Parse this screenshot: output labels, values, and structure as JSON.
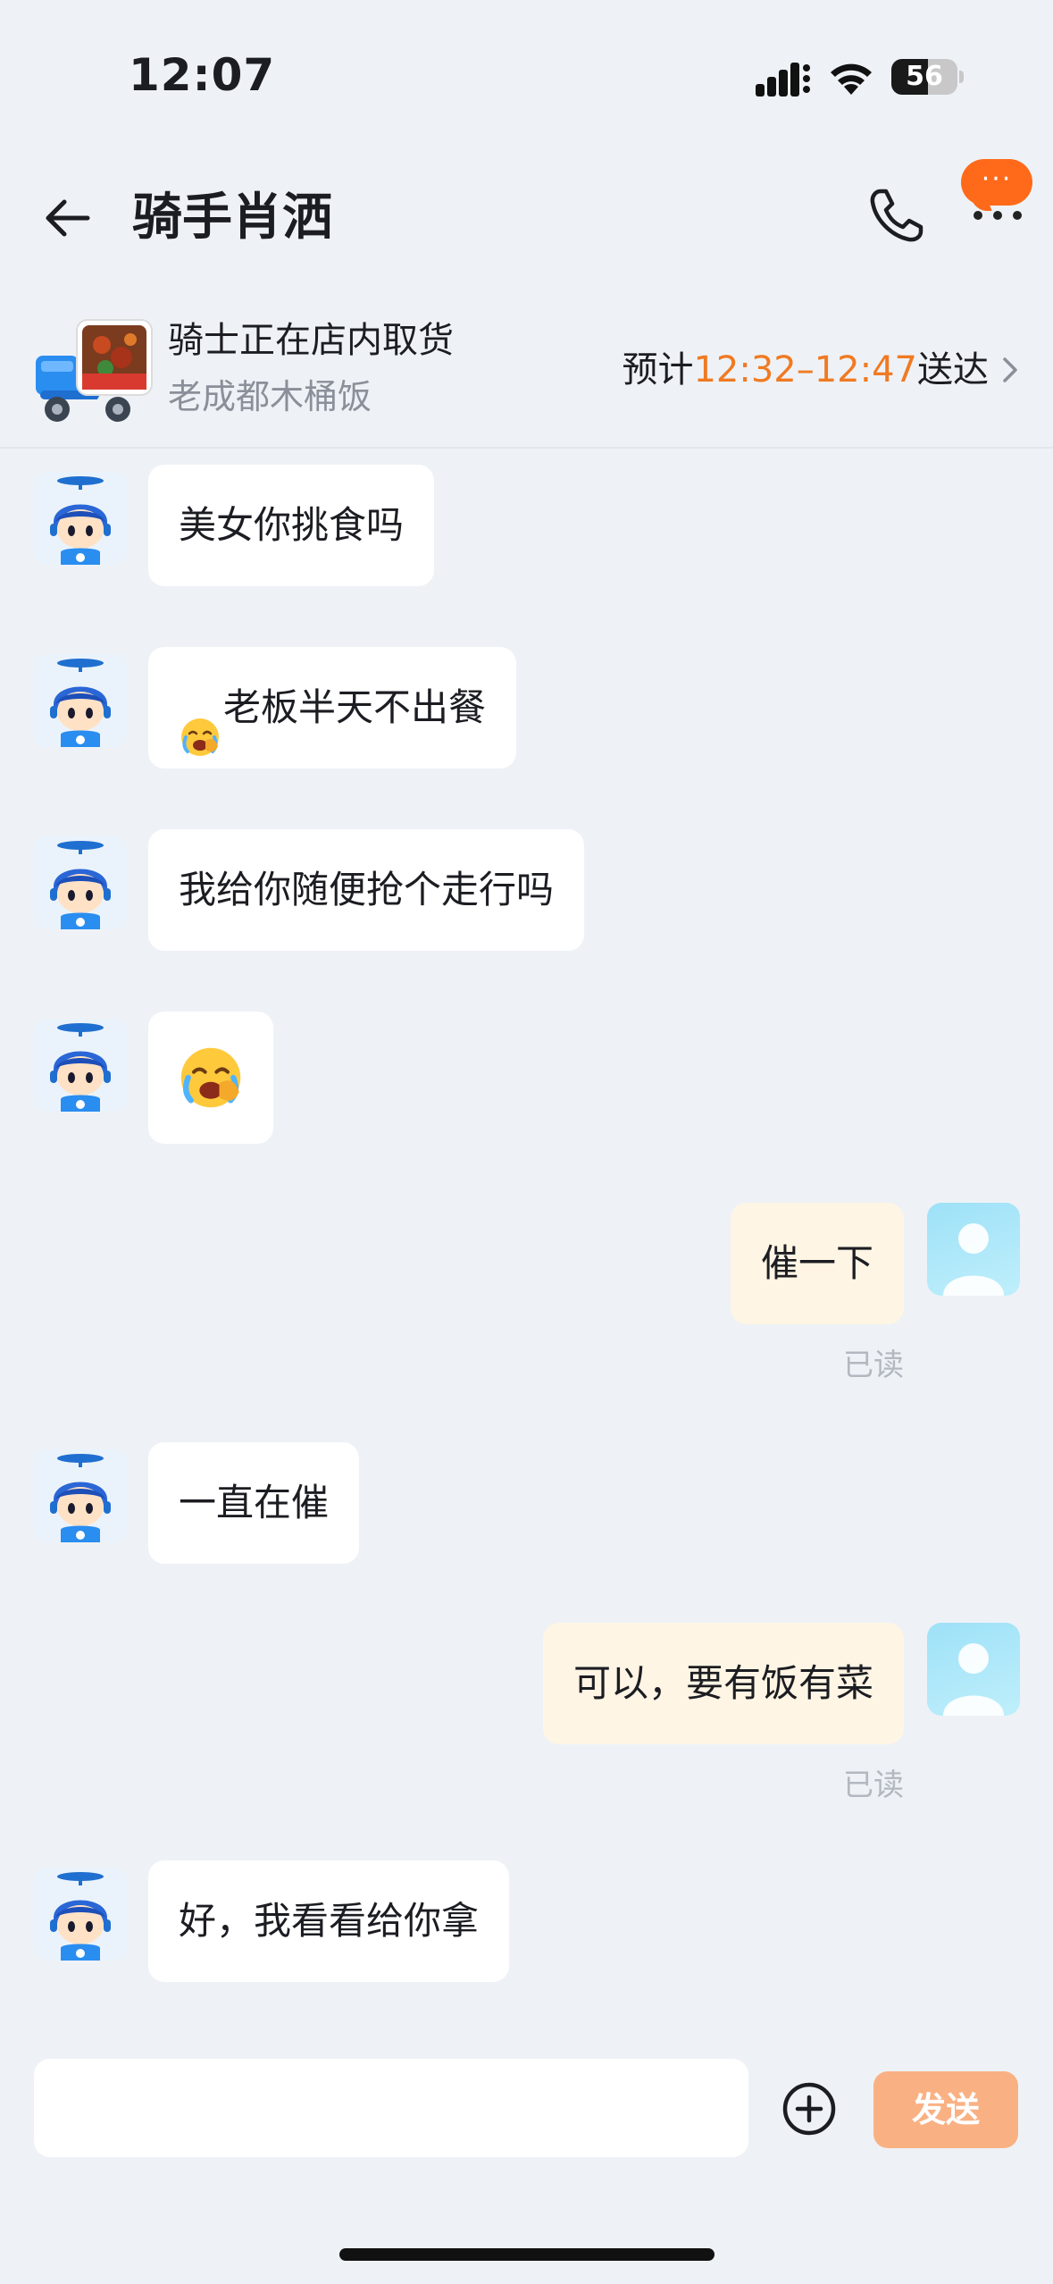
{
  "status_bar": {
    "time": "12:07",
    "battery": "56",
    "battery_level": 0.56
  },
  "nav": {
    "title": "骑手肖洒"
  },
  "order": {
    "status": "骑士正在店内取货",
    "shop": "老成都木桶饭",
    "eta_prefix": "预计",
    "eta_time": "12:32–12:47",
    "eta_suffix": "送达"
  },
  "messages": [
    {
      "from": "rider",
      "text": "美女你挑食吗"
    },
    {
      "from": "rider",
      "emoji": "crying-face",
      "text": "老板半天不出餐"
    },
    {
      "from": "rider",
      "text": "我给你随便抢个走行吗"
    },
    {
      "from": "rider",
      "emoji": "crying-face",
      "text": ""
    },
    {
      "from": "me",
      "text": "催一下",
      "status": "已读"
    },
    {
      "from": "rider",
      "text": "一直在催"
    },
    {
      "from": "me",
      "text": "可以，要有饭有菜",
      "status": "已读"
    },
    {
      "from": "rider",
      "text": "好，我看看给你拿"
    }
  ],
  "input": {
    "placeholder": "",
    "send_label": "发送"
  },
  "colors": {
    "accent": "#f07a22",
    "send_disabled": "#f9b184",
    "out_bubble": "#fff5e4",
    "background": "#eef2f6"
  }
}
